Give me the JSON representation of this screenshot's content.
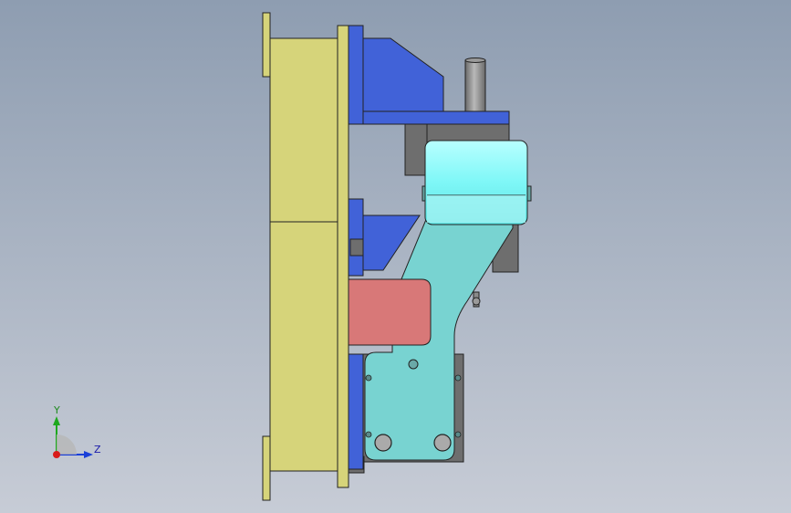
{
  "triad": {
    "y_label": "Y",
    "z_label": "Z",
    "colors": {
      "y": "#1ea81e",
      "z": "#1a3fd8",
      "origin": "#d81a1a"
    }
  },
  "viewport": {
    "background": [
      "#8e9db1",
      "#c7ccd6"
    ]
  },
  "parts": {
    "plate": "#d6d47a",
    "blue": "#4162d8",
    "roller": "#7ef7f7",
    "arm": "#78d3d1",
    "red_block": "#d87878",
    "shaft": "#8a8a8a",
    "dark": "#6e6e6e"
  }
}
